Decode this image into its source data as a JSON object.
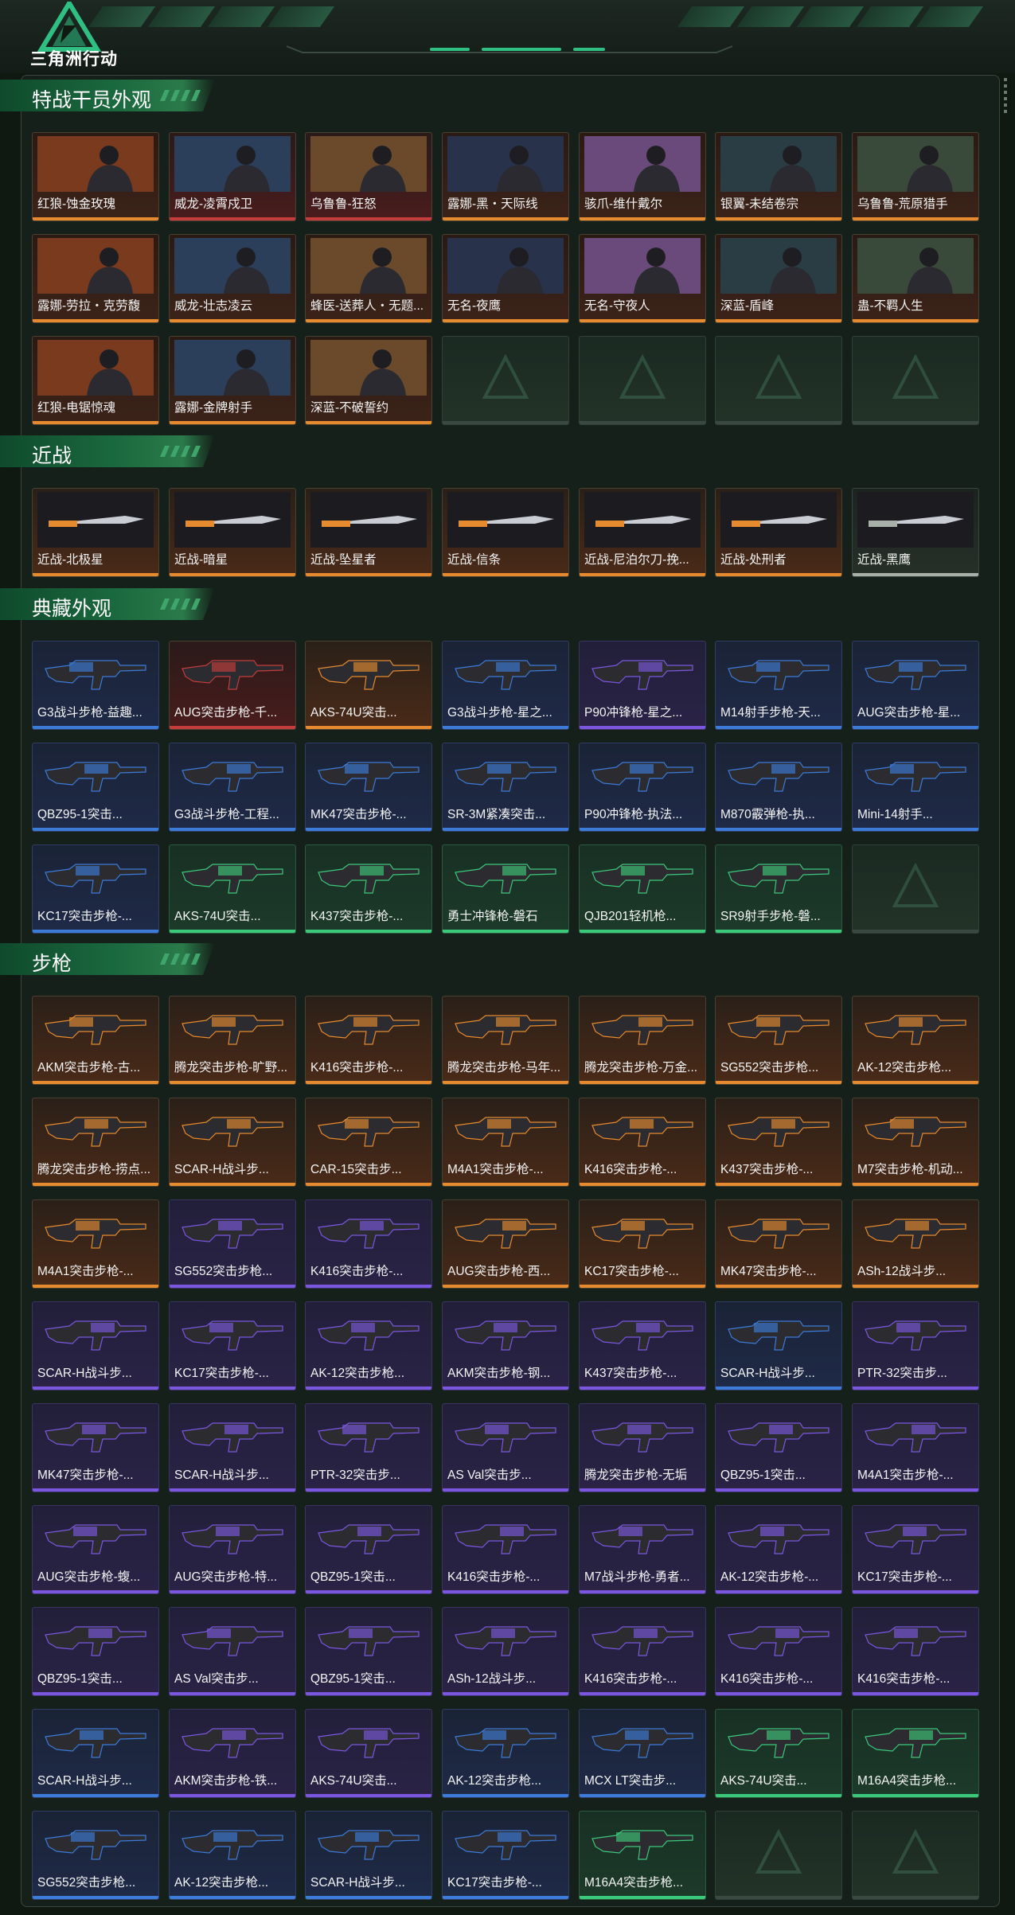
{
  "app": {
    "logo_text": "三角洲行动"
  },
  "sections": [
    {
      "title": "特战干员外观",
      "quality": "q-skin",
      "rows": 3,
      "items": [
        "红狼-蚀金玫瑰",
        "威龙-凌霄戍卫",
        "乌鲁鲁-狂怒",
        "露娜-黑・天际线",
        "骇爪-维什戴尔",
        "银翼-未结卷宗",
        "乌鲁鲁-荒原猎手",
        "露娜-劳拉・克劳馥",
        "威龙-壮志凌云",
        "蜂医-送葬人・无题...",
        "无名-夜鹰",
        "无名-守夜人",
        "深蓝-盾峰",
        "蛊-不羁人生",
        "红狼-电锯惊魂",
        "露娜-金牌射手",
        "深蓝-不破誓约",
        "",
        "",
        "",
        ""
      ]
    },
    {
      "title": "近战",
      "quality": "q-orange",
      "rows": 1,
      "items": [
        "近战-北极星",
        "近战-暗星",
        "近战-坠星者",
        "近战-信条",
        "近战-尼泊尔刀-挽...",
        "近战-处刑者",
        "近战-黑鹰"
      ]
    },
    {
      "title": "典藏外观",
      "quality": "mixed",
      "rows": 3,
      "items": [
        "G3战斗步枪-益趣...",
        "AUG突击步枪-千...",
        "AKS-74U突击...",
        "G3战斗步枪-星之...",
        "P90冲锋枪-星之...",
        "M14射手步枪-天...",
        "AUG突击步枪-星...",
        "QBZ95-1突击...",
        "G3战斗步枪-工程...",
        "MK47突击步枪-...",
        "SR-3M紧凑突击...",
        "P90冲锋枪-执法...",
        "M870霰弹枪-执...",
        "Mini-14射手...",
        "KC17突击步枪-...",
        "AKS-74U突击...",
        "K437突击步枪-...",
        "勇士冲锋枪-磐石",
        "QJB201轻机枪...",
        "SR9射手步枪-磐...",
        ""
      ]
    },
    {
      "title": "步枪",
      "quality": "mixed",
      "rows": 9,
      "items": [
        "AKM突击步枪-古...",
        "腾龙突击步枪-旷野...",
        "K416突击步枪-...",
        "腾龙突击步枪-马年...",
        "腾龙突击步枪-万金...",
        "SG552突击步枪...",
        "AK-12突击步枪...",
        "腾龙突击步枪-捞点...",
        "SCAR-H战斗步...",
        "CAR-15突击步...",
        "M4A1突击步枪-...",
        "K416突击步枪-...",
        "K437突击步枪-...",
        "M7突击步枪-机动...",
        "M4A1突击步枪-...",
        "SG552突击步枪...",
        "K416突击步枪-...",
        "AUG突击步枪-西...",
        "KC17突击步枪-...",
        "MK47突击步枪-...",
        "ASh-12战斗步...",
        "SCAR-H战斗步...",
        "KC17突击步枪-...",
        "AK-12突击步枪...",
        "AKM突击步枪-钢...",
        "K437突击步枪-...",
        "SCAR-H战斗步...",
        "PTR-32突击步...",
        "MK47突击步枪-...",
        "SCAR-H战斗步...",
        "PTR-32突击步...",
        "AS Val突击步...",
        "腾龙突击步枪-无垢",
        "QBZ95-1突击...",
        "M4A1突击步枪-...",
        "AUG突击步枪-蝮...",
        "AUG突击步枪-特...",
        "QBZ95-1突击...",
        "K416突击步枪-...",
        "M7战斗步枪-勇者...",
        "AK-12突击步枪-...",
        "KC17突击步枪-...",
        "QBZ95-1突击...",
        "AS Val突击步...",
        "QBZ95-1突击...",
        "ASh-12战斗步...",
        "K416突击步枪-...",
        "K416突击步枪-...",
        "K416突击步枪-...",
        "SCAR-H战斗步...",
        "AKM突击步枪-铁...",
        "AKS-74U突击...",
        "AK-12突击步枪...",
        "MCX LT突击步...",
        "AKS-74U突击...",
        "M16A4突击步枪...",
        "SG552突击步枪...",
        "AK-12突击步枪...",
        "SCAR-H战斗步...",
        "KC17突击步枪-...",
        "M16A4突击步枪...",
        "",
        ""
      ]
    }
  ],
  "colors": {
    "bg": "#0f1912",
    "accent": "#2fbf83",
    "orange": "#e58a2e",
    "purple": "#7b57e0",
    "blue": "#3c7bd8",
    "green": "#3cc87a",
    "red": "#c43c3c"
  }
}
